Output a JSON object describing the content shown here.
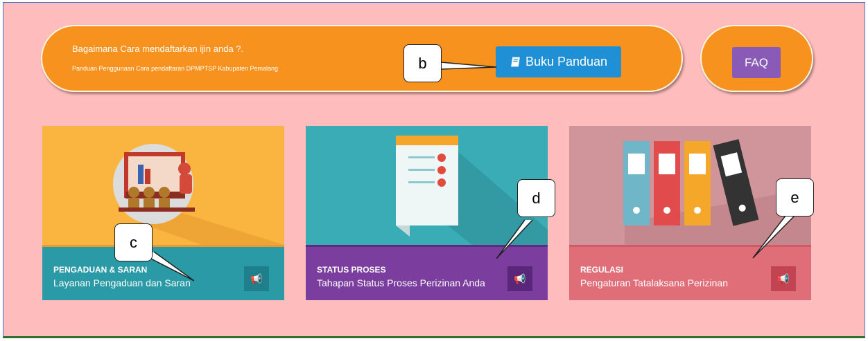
{
  "banner": {
    "title": "Bagaimana Cara mendaftarkan ijin anda ?.",
    "subtitle": "Panduan Penggunaan Cara pendaftaran DPMPTSP Kabupaten Pemalang",
    "guide_button": "Buku Panduan",
    "guide_icon": "book-icon"
  },
  "faq": {
    "label": "FAQ"
  },
  "cards": [
    {
      "title": "PENGADUAN & SARAN",
      "subtitle": "Layanan Pengaduan dan Saran",
      "icon": "megaphone-icon"
    },
    {
      "title": "STATUS PROSES",
      "subtitle": "Tahapan Status Proses Perizinan Anda",
      "icon": "megaphone-icon"
    },
    {
      "title": "REGULASI",
      "subtitle": "Pengaturan Tatalaksana Perizinan",
      "icon": "megaphone-icon"
    }
  ],
  "callouts": {
    "b": "b",
    "c": "c",
    "d": "d",
    "e": "e"
  },
  "colors": {
    "background": "#ffbcbc",
    "banner": "#f7921e",
    "guide_button": "#1f8fd6",
    "faq_button": "#8a5bb6",
    "card1_bar": "#2a9aa6",
    "card2_bar": "#7b3e9f",
    "card3_bar": "#e06e79"
  }
}
